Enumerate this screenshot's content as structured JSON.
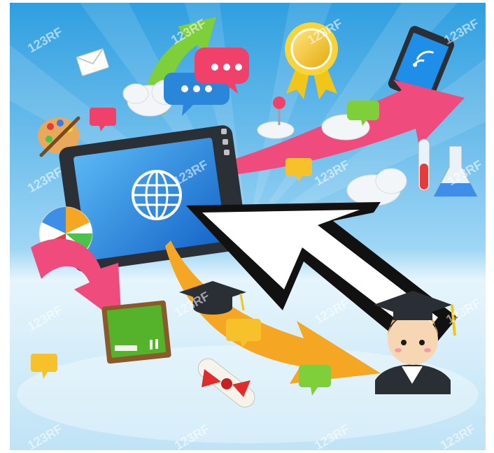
{
  "illustration": {
    "subject": "",
    "palette": {
      "sky_top": "#2f9fe0",
      "sky_mid": "#9fd6f5",
      "floor": "#dff1fb",
      "pink_arrow": "#ef4b7c",
      "green_arrow": "#7fcf3a",
      "orange_arrow": "#f5a623",
      "bubble_red": "#f0416a",
      "bubble_blue": "#2a86d8",
      "screen_blue": "#1d7fd8",
      "medal_gold": "#f2c619",
      "board_green": "#55b32b"
    },
    "watermark_text": "123RF"
  }
}
